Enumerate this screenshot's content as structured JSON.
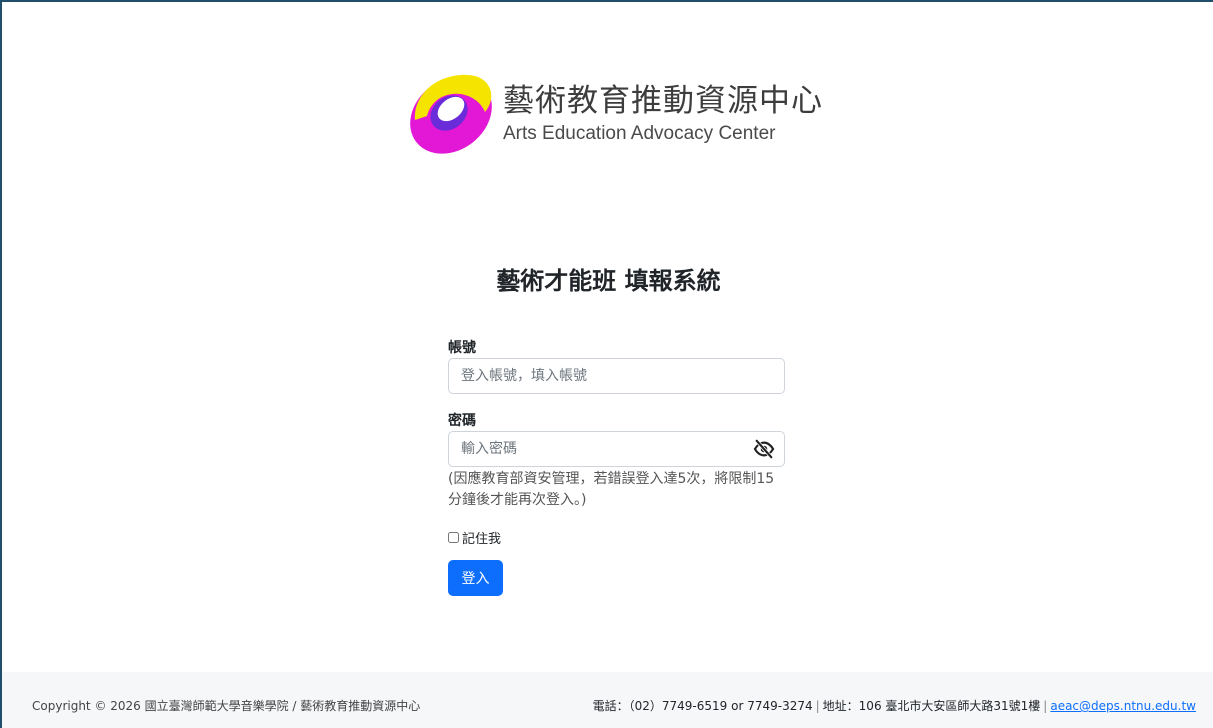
{
  "logo": {
    "name_cn": "藝術教育推動資源中心",
    "name_en": "Arts Education Advocacy Center",
    "colors": {
      "yellow": "#f5e400",
      "magenta": "#e318d6",
      "purple": "#6a2bd9"
    }
  },
  "page": {
    "title": "藝術才能班 填報系統"
  },
  "form": {
    "account_label": "帳號",
    "account_placeholder": "登入帳號，填入帳號",
    "password_label": "密碼",
    "password_placeholder": "輸入密碼",
    "password_toggle_icon": "eye-slash-icon",
    "note": "(因應教育部資安管理，若錯誤登入達5次，將限制15分鐘後才能再次登入。)",
    "remember_label": "記住我",
    "login_label": "登入"
  },
  "footer": {
    "copyright": "Copyright © 2026 國立臺灣師範大學音樂學院 / 藝術教育推動資源中心",
    "phone": "電話：（02）7749-6519 or 7749-3274",
    "address": "地址：106 臺北市大安區師大路31號1樓",
    "email": "aeac@deps.ntnu.edu.tw"
  },
  "colors": {
    "primary": "#0d6efd",
    "border": "#1f4f6b"
  }
}
